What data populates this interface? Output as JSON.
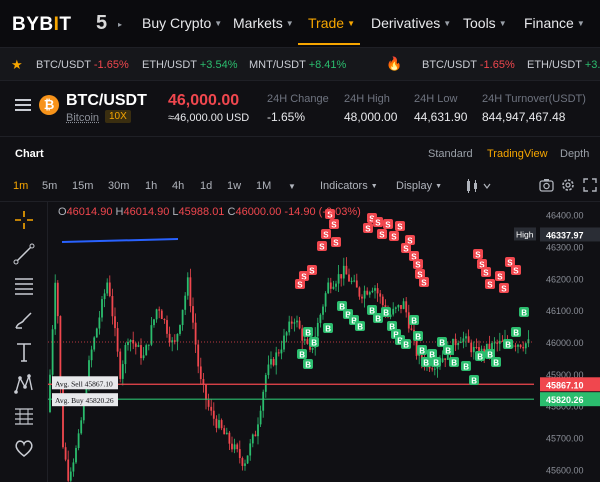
{
  "brand": {
    "logo_text": "BYB",
    "logo_dot": "I",
    "logo_tail": "T",
    "five_label": "5"
  },
  "nav": {
    "items": [
      {
        "label": "Buy Crypto",
        "caret": "▼",
        "active": false
      },
      {
        "label": "Markets",
        "caret": "▼",
        "active": false
      },
      {
        "label": "Trade",
        "caret": "▼",
        "active": true
      },
      {
        "label": "Derivatives",
        "caret": "▼",
        "active": false
      },
      {
        "label": "Tools",
        "caret": "▼",
        "active": false
      },
      {
        "label": "Finance",
        "caret": "▼",
        "active": false
      }
    ]
  },
  "ticker": [
    {
      "pair": "BTC/USDT",
      "change": "-1.65%",
      "dir": "neg"
    },
    {
      "pair": "ETH/USDT",
      "change": "+3.54%",
      "dir": "pos"
    },
    {
      "pair": "MNT/USDT",
      "change": "+8.41%",
      "dir": "pos"
    },
    {
      "pair": "BTC/USDT",
      "change": "-1.65%",
      "dir": "neg"
    },
    {
      "pair": "ETH/USDT",
      "change": "+3.",
      "dir": "pos"
    }
  ],
  "pair": {
    "name": "BTC/USDT",
    "asset": "Bitcoin",
    "leverage": "10X",
    "price": "46,000.00",
    "price_usd": "≈46,000.00 USD",
    "stats": [
      {
        "label": "24H Change",
        "value": "-1.65%",
        "dir": "neg"
      },
      {
        "label": "24H High",
        "value": "48,000.00",
        "dir": ""
      },
      {
        "label": "24H Low",
        "value": "44,631.90",
        "dir": ""
      },
      {
        "label": "24H Turnover(USDT)",
        "value": "844,947,467.48",
        "dir": ""
      }
    ]
  },
  "chart_header": {
    "title": "Chart",
    "modes": [
      {
        "label": "Standard",
        "active": false
      },
      {
        "label": "TradingView",
        "active": true
      },
      {
        "label": "Depth",
        "active": false
      }
    ]
  },
  "toolbar": {
    "timeframes": [
      {
        "label": "1m",
        "active": true
      },
      {
        "label": "5m",
        "active": false
      },
      {
        "label": "15m",
        "active": false
      },
      {
        "label": "30m",
        "active": false
      },
      {
        "label": "1h",
        "active": false
      },
      {
        "label": "4h",
        "active": false
      },
      {
        "label": "1d",
        "active": false
      },
      {
        "label": "1w",
        "active": false
      },
      {
        "label": "1M",
        "active": false
      }
    ],
    "more_caret": "▼",
    "indicators_label": "Indicators",
    "display_label": "Display"
  },
  "ohlc": {
    "o_key": "O",
    "o_val": "46014.90",
    "h_key": "H",
    "h_val": "46014.90",
    "l_key": "L",
    "l_val": "45988.01",
    "c_key": "C",
    "c_val": "46000.00",
    "change": "-14.90 (-0.03%)"
  },
  "chart_data": {
    "type": "candlestick",
    "y_ticks": [
      46400,
      46300,
      46200,
      46100,
      46000,
      45900,
      45800,
      45700,
      45600
    ],
    "y_tick_labels": [
      "46400.00",
      "46300.00",
      "46200.00",
      "46100.00",
      "46000.00",
      "45900.00",
      "45800.00",
      "45700.00",
      "45600.00"
    ],
    "ylim": [
      45560,
      46440
    ],
    "current_price": 46000,
    "high_marker": {
      "label": "High",
      "value": 46337.97,
      "value_label": "46337.97"
    },
    "avg_sell": {
      "label": "Avg. Sell 45867.10",
      "value": 45867.1,
      "value_label": "45867.10"
    },
    "avg_buy": {
      "label": "Avg. Buy 45820.26",
      "value": 45820.26,
      "value_label": "45820.26"
    },
    "buy_marker_label": "B",
    "sell_marker_label": "S",
    "up_color": "#2bbd6e",
    "down_color": "#f0474e",
    "trend_line_color": "#2962ff"
  },
  "colors": {
    "accent": "#f7a600",
    "negative": "#f0474e",
    "positive": "#2bbd6e",
    "background": "#101014"
  }
}
